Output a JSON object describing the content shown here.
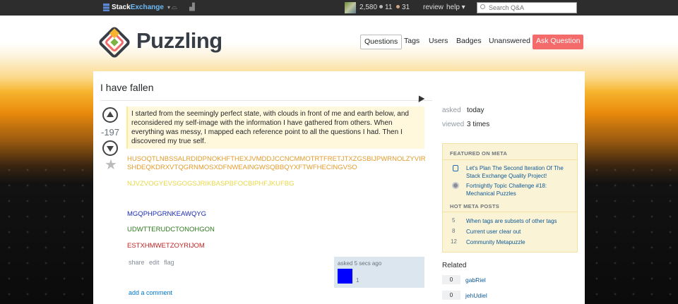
{
  "topbar": {
    "brand_stack": "Stack",
    "brand_exchange": "Exchange",
    "caret": "▾",
    "inbox_icon": "inbox-icon",
    "achievements_icon": "achievements-icon",
    "reputation": "2,580",
    "silver_badges": "11",
    "bronze_badges": "31",
    "badge_colors": {
      "silver": "#b4b8bc",
      "bronze": "#d1a684"
    },
    "review": "review",
    "help": "help ▾",
    "search_placeholder": "Search Q&A"
  },
  "header": {
    "site_name": "Puzzling",
    "nav": [
      "Questions",
      "Tags",
      "Users",
      "Badges",
      "Unanswered"
    ],
    "ask_question": "Ask Question",
    "accent": "#f46b6b"
  },
  "question": {
    "title": "I have fallen",
    "votes": "-197",
    "spoiler_text": "I started from the seemingly perfect state, with clouds in front of me and earth below, and reconsidered my self-image with the information I have gathered from others. When everything was messy, I mapped each reference point to all the questions I had. Then I discovered my true self.",
    "cipher_orange": "HUSOQTLNBSSALRDIDPNOKHFTHEXJVMDDJCCNCMMOTRTFRETJTXZGSBIJPWRNOLZYVIRSHDEQKDRXVTQGRNMOSXDFNWEAINGWSQBBQYXFTWFHECINGVSO",
    "cipher_yellow": "NJVZVOGYEVSGOGSJRIKBASPBFOCBIPHFJKUFBG",
    "cipher_blue": "MGQPHPGRNKEAWQYG",
    "cipher_green": "UDWTTERUDCTONOHGON",
    "cipher_red": "ESTXHMWETZOYRIJOM",
    "menu": [
      "share",
      "edit",
      "flag"
    ],
    "signature_time": "asked 5 secs ago",
    "signature_rep": "1",
    "add_comment": "add a comment"
  },
  "sidebar": {
    "asked_label": "asked",
    "asked_value": "today",
    "viewed_label": "viewed",
    "viewed_value": "3 times",
    "featured_head": "FEATURED ON META",
    "featured": [
      "Let's Plan The Second Iteration Of The Stack Exchange Quality Project!",
      "Fortnightly Topic Challenge #18: Mechanical Puzzles"
    ],
    "hot_head": "HOT META POSTS",
    "hot": [
      {
        "num": "5",
        "title": "When tags are subsets of other tags"
      },
      {
        "num": "8",
        "title": "Current user clear out"
      },
      {
        "num": "12",
        "title": "Community Metapuzzle"
      }
    ],
    "related_head": "Related",
    "related": [
      {
        "count": "0",
        "title": "gabRiel"
      },
      {
        "count": "0",
        "title": "jehUdiel"
      }
    ]
  }
}
